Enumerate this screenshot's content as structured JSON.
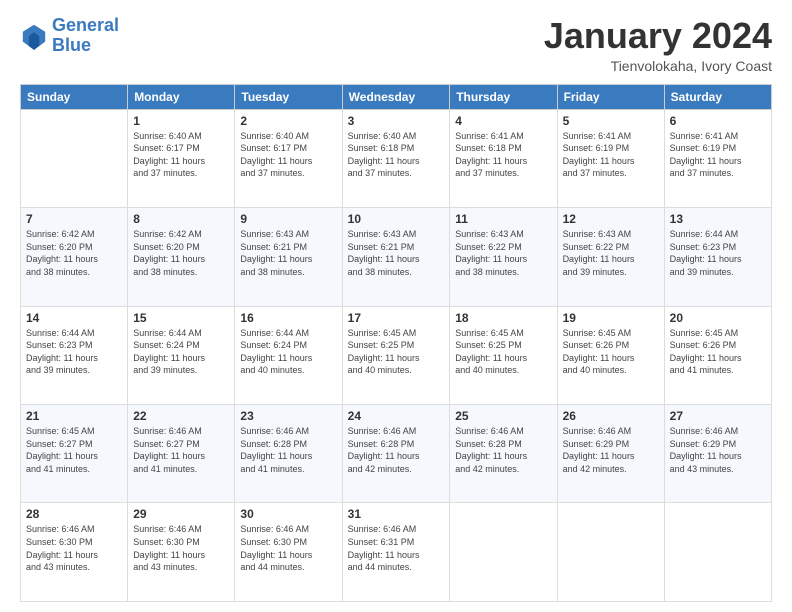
{
  "header": {
    "logo_line1": "General",
    "logo_line2": "Blue",
    "month": "January 2024",
    "location": "Tienvolokaha, Ivory Coast"
  },
  "days_of_week": [
    "Sunday",
    "Monday",
    "Tuesday",
    "Wednesday",
    "Thursday",
    "Friday",
    "Saturday"
  ],
  "weeks": [
    [
      {
        "day": "",
        "info": ""
      },
      {
        "day": "1",
        "info": "Sunrise: 6:40 AM\nSunset: 6:17 PM\nDaylight: 11 hours\nand 37 minutes."
      },
      {
        "day": "2",
        "info": "Sunrise: 6:40 AM\nSunset: 6:17 PM\nDaylight: 11 hours\nand 37 minutes."
      },
      {
        "day": "3",
        "info": "Sunrise: 6:40 AM\nSunset: 6:18 PM\nDaylight: 11 hours\nand 37 minutes."
      },
      {
        "day": "4",
        "info": "Sunrise: 6:41 AM\nSunset: 6:18 PM\nDaylight: 11 hours\nand 37 minutes."
      },
      {
        "day": "5",
        "info": "Sunrise: 6:41 AM\nSunset: 6:19 PM\nDaylight: 11 hours\nand 37 minutes."
      },
      {
        "day": "6",
        "info": "Sunrise: 6:41 AM\nSunset: 6:19 PM\nDaylight: 11 hours\nand 37 minutes."
      }
    ],
    [
      {
        "day": "7",
        "info": "Sunrise: 6:42 AM\nSunset: 6:20 PM\nDaylight: 11 hours\nand 38 minutes."
      },
      {
        "day": "8",
        "info": "Sunrise: 6:42 AM\nSunset: 6:20 PM\nDaylight: 11 hours\nand 38 minutes."
      },
      {
        "day": "9",
        "info": "Sunrise: 6:43 AM\nSunset: 6:21 PM\nDaylight: 11 hours\nand 38 minutes."
      },
      {
        "day": "10",
        "info": "Sunrise: 6:43 AM\nSunset: 6:21 PM\nDaylight: 11 hours\nand 38 minutes."
      },
      {
        "day": "11",
        "info": "Sunrise: 6:43 AM\nSunset: 6:22 PM\nDaylight: 11 hours\nand 38 minutes."
      },
      {
        "day": "12",
        "info": "Sunrise: 6:43 AM\nSunset: 6:22 PM\nDaylight: 11 hours\nand 39 minutes."
      },
      {
        "day": "13",
        "info": "Sunrise: 6:44 AM\nSunset: 6:23 PM\nDaylight: 11 hours\nand 39 minutes."
      }
    ],
    [
      {
        "day": "14",
        "info": "Sunrise: 6:44 AM\nSunset: 6:23 PM\nDaylight: 11 hours\nand 39 minutes."
      },
      {
        "day": "15",
        "info": "Sunrise: 6:44 AM\nSunset: 6:24 PM\nDaylight: 11 hours\nand 39 minutes."
      },
      {
        "day": "16",
        "info": "Sunrise: 6:44 AM\nSunset: 6:24 PM\nDaylight: 11 hours\nand 40 minutes."
      },
      {
        "day": "17",
        "info": "Sunrise: 6:45 AM\nSunset: 6:25 PM\nDaylight: 11 hours\nand 40 minutes."
      },
      {
        "day": "18",
        "info": "Sunrise: 6:45 AM\nSunset: 6:25 PM\nDaylight: 11 hours\nand 40 minutes."
      },
      {
        "day": "19",
        "info": "Sunrise: 6:45 AM\nSunset: 6:26 PM\nDaylight: 11 hours\nand 40 minutes."
      },
      {
        "day": "20",
        "info": "Sunrise: 6:45 AM\nSunset: 6:26 PM\nDaylight: 11 hours\nand 41 minutes."
      }
    ],
    [
      {
        "day": "21",
        "info": "Sunrise: 6:45 AM\nSunset: 6:27 PM\nDaylight: 11 hours\nand 41 minutes."
      },
      {
        "day": "22",
        "info": "Sunrise: 6:46 AM\nSunset: 6:27 PM\nDaylight: 11 hours\nand 41 minutes."
      },
      {
        "day": "23",
        "info": "Sunrise: 6:46 AM\nSunset: 6:28 PM\nDaylight: 11 hours\nand 41 minutes."
      },
      {
        "day": "24",
        "info": "Sunrise: 6:46 AM\nSunset: 6:28 PM\nDaylight: 11 hours\nand 42 minutes."
      },
      {
        "day": "25",
        "info": "Sunrise: 6:46 AM\nSunset: 6:28 PM\nDaylight: 11 hours\nand 42 minutes."
      },
      {
        "day": "26",
        "info": "Sunrise: 6:46 AM\nSunset: 6:29 PM\nDaylight: 11 hours\nand 42 minutes."
      },
      {
        "day": "27",
        "info": "Sunrise: 6:46 AM\nSunset: 6:29 PM\nDaylight: 11 hours\nand 43 minutes."
      }
    ],
    [
      {
        "day": "28",
        "info": "Sunrise: 6:46 AM\nSunset: 6:30 PM\nDaylight: 11 hours\nand 43 minutes."
      },
      {
        "day": "29",
        "info": "Sunrise: 6:46 AM\nSunset: 6:30 PM\nDaylight: 11 hours\nand 43 minutes."
      },
      {
        "day": "30",
        "info": "Sunrise: 6:46 AM\nSunset: 6:30 PM\nDaylight: 11 hours\nand 44 minutes."
      },
      {
        "day": "31",
        "info": "Sunrise: 6:46 AM\nSunset: 6:31 PM\nDaylight: 11 hours\nand 44 minutes."
      },
      {
        "day": "",
        "info": ""
      },
      {
        "day": "",
        "info": ""
      },
      {
        "day": "",
        "info": ""
      }
    ]
  ]
}
